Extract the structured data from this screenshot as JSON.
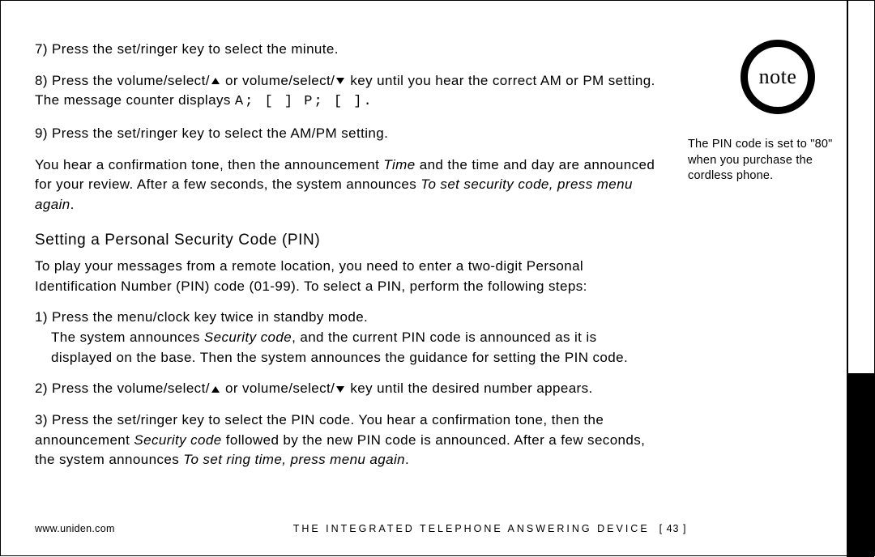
{
  "steps": {
    "s7": "7) Press the set/ringer key to select the minute.",
    "s8a": "8) Press the volume/select/",
    "s8b": " or volume/select/",
    "s8c": " key until you hear the correct AM or PM setting. The message counter displays ",
    "s8d": "A; [  ] P; [  ].",
    "s9": "9) Press the set/ringer key to select the AM/PM setting."
  },
  "paraTime": {
    "a": "You hear a confirmation tone, then the announcement ",
    "b": "Time",
    "c": " and the time and day are announced for your review. After a few seconds, the system announces ",
    "d": "To set security code, press menu again",
    "e": "."
  },
  "heading": "Setting a Personal Security Code (PIN)",
  "paraPinIntro": "To play your messages from a remote location, you need to enter a two-digit Personal Identification Number (PIN) code (01-99). To select a PIN, perform the following steps:",
  "pinSteps": {
    "p1a": "1) Press the menu/clock key twice in standby mode.",
    "p1b": "The system announces ",
    "p1c": "Security code",
    "p1d": ", and the current PIN code is announced as it is displayed on the base. Then the system announces the guidance for setting the PIN code.",
    "p2a": "2) Press the volume/select/",
    "p2b": " or volume/select/",
    "p2c": " key until the desired number appears.",
    "p3a": "3) Press the set/ringer key to select the PIN code. You hear a confirmation tone, then the announcement ",
    "p3b": "Security code",
    "p3c": " followed by the new PIN code is announced. After a few seconds, the system announces ",
    "p3d": "To set ring time, press menu again",
    "p3e": "."
  },
  "note": {
    "label": "note",
    "text": "The PIN code is set to \"80\" when you purchase the cordless phone."
  },
  "footer": {
    "url": "www.uniden.com",
    "title": "THE INTEGRATED TELEPHONE ANSWERING DEVICE",
    "page": "[ 43 ]"
  }
}
